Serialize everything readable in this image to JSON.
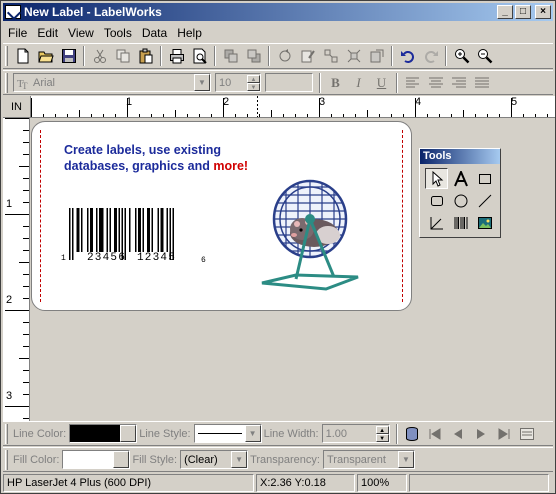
{
  "window": {
    "title": "New Label - LabelWorks"
  },
  "menu": [
    "File",
    "Edit",
    "View",
    "Tools",
    "Data",
    "Help"
  ],
  "format_bar": {
    "font": "Arial",
    "size": "10",
    "bold": "B",
    "italic": "I",
    "underline": "U"
  },
  "ruler": {
    "unit": "IN",
    "h_marks": [
      "1",
      "2",
      "3",
      "4",
      "5"
    ],
    "v_marks": [
      "1",
      "2",
      "3"
    ]
  },
  "label": {
    "line1": "Create labels, use existing",
    "line2_blue": "databases, graphics and ",
    "line2_red": "more!",
    "barcode_first": "1",
    "barcode_left": "23456",
    "barcode_right": "12345",
    "barcode_check": "6"
  },
  "tools_panel": {
    "title": "Tools"
  },
  "line_bar": {
    "line_color_label": "Line Color:",
    "line_style_label": "Line Style:",
    "line_width_label": "Line Width:",
    "line_width_value": "1.00"
  },
  "fill_bar": {
    "fill_color_label": "Fill Color:",
    "fill_style_label": "Fill Style:",
    "fill_style_value": "(Clear)",
    "transparency_label": "Transparency:",
    "transparency_value": "Transparent"
  },
  "status": {
    "printer": "HP LaserJet 4 Plus (600 DPI)",
    "coords": "X:2.36 Y:0.18",
    "zoom": "100%"
  }
}
